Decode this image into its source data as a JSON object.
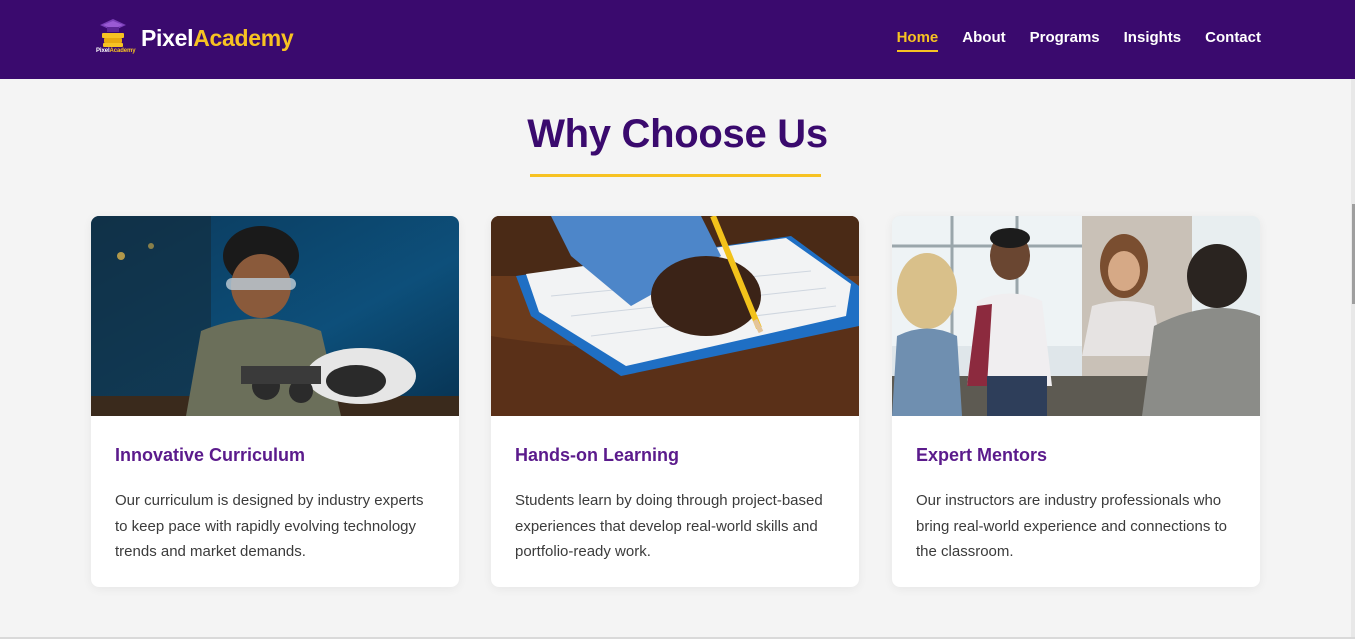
{
  "brand": {
    "name_part1": "Pixel",
    "name_part2": "Academy",
    "mini_part1": "Pixel",
    "mini_part2": "Academy",
    "logo_icon": "graduation-cap-books-icon"
  },
  "nav": {
    "items": [
      {
        "label": "Home",
        "active": true
      },
      {
        "label": "About",
        "active": false
      },
      {
        "label": "Programs",
        "active": false
      },
      {
        "label": "Insights",
        "active": false
      },
      {
        "label": "Contact",
        "active": false
      }
    ]
  },
  "section": {
    "title": "Why Choose Us"
  },
  "cards": [
    {
      "title": "Innovative Curriculum",
      "text": "Our curriculum is designed by industry experts to keep pace with rapidly evolving technology trends and market demands.",
      "image": "student-building-robot-photo"
    },
    {
      "title": "Hands-on Learning",
      "text": "Students learn by doing through project-based experiences that develop real-world skills and portfolio-ready work.",
      "image": "hand-writing-notebook-photo"
    },
    {
      "title": "Expert Mentors",
      "text": "Our instructors are industry professionals who bring real-world experience and connections to the classroom.",
      "image": "group-discussion-photo"
    }
  ],
  "colors": {
    "header_bg": "#3a0a6e",
    "accent": "#f7c222",
    "card_title": "#5b1b8c",
    "page_bg": "#f4f4f4"
  }
}
